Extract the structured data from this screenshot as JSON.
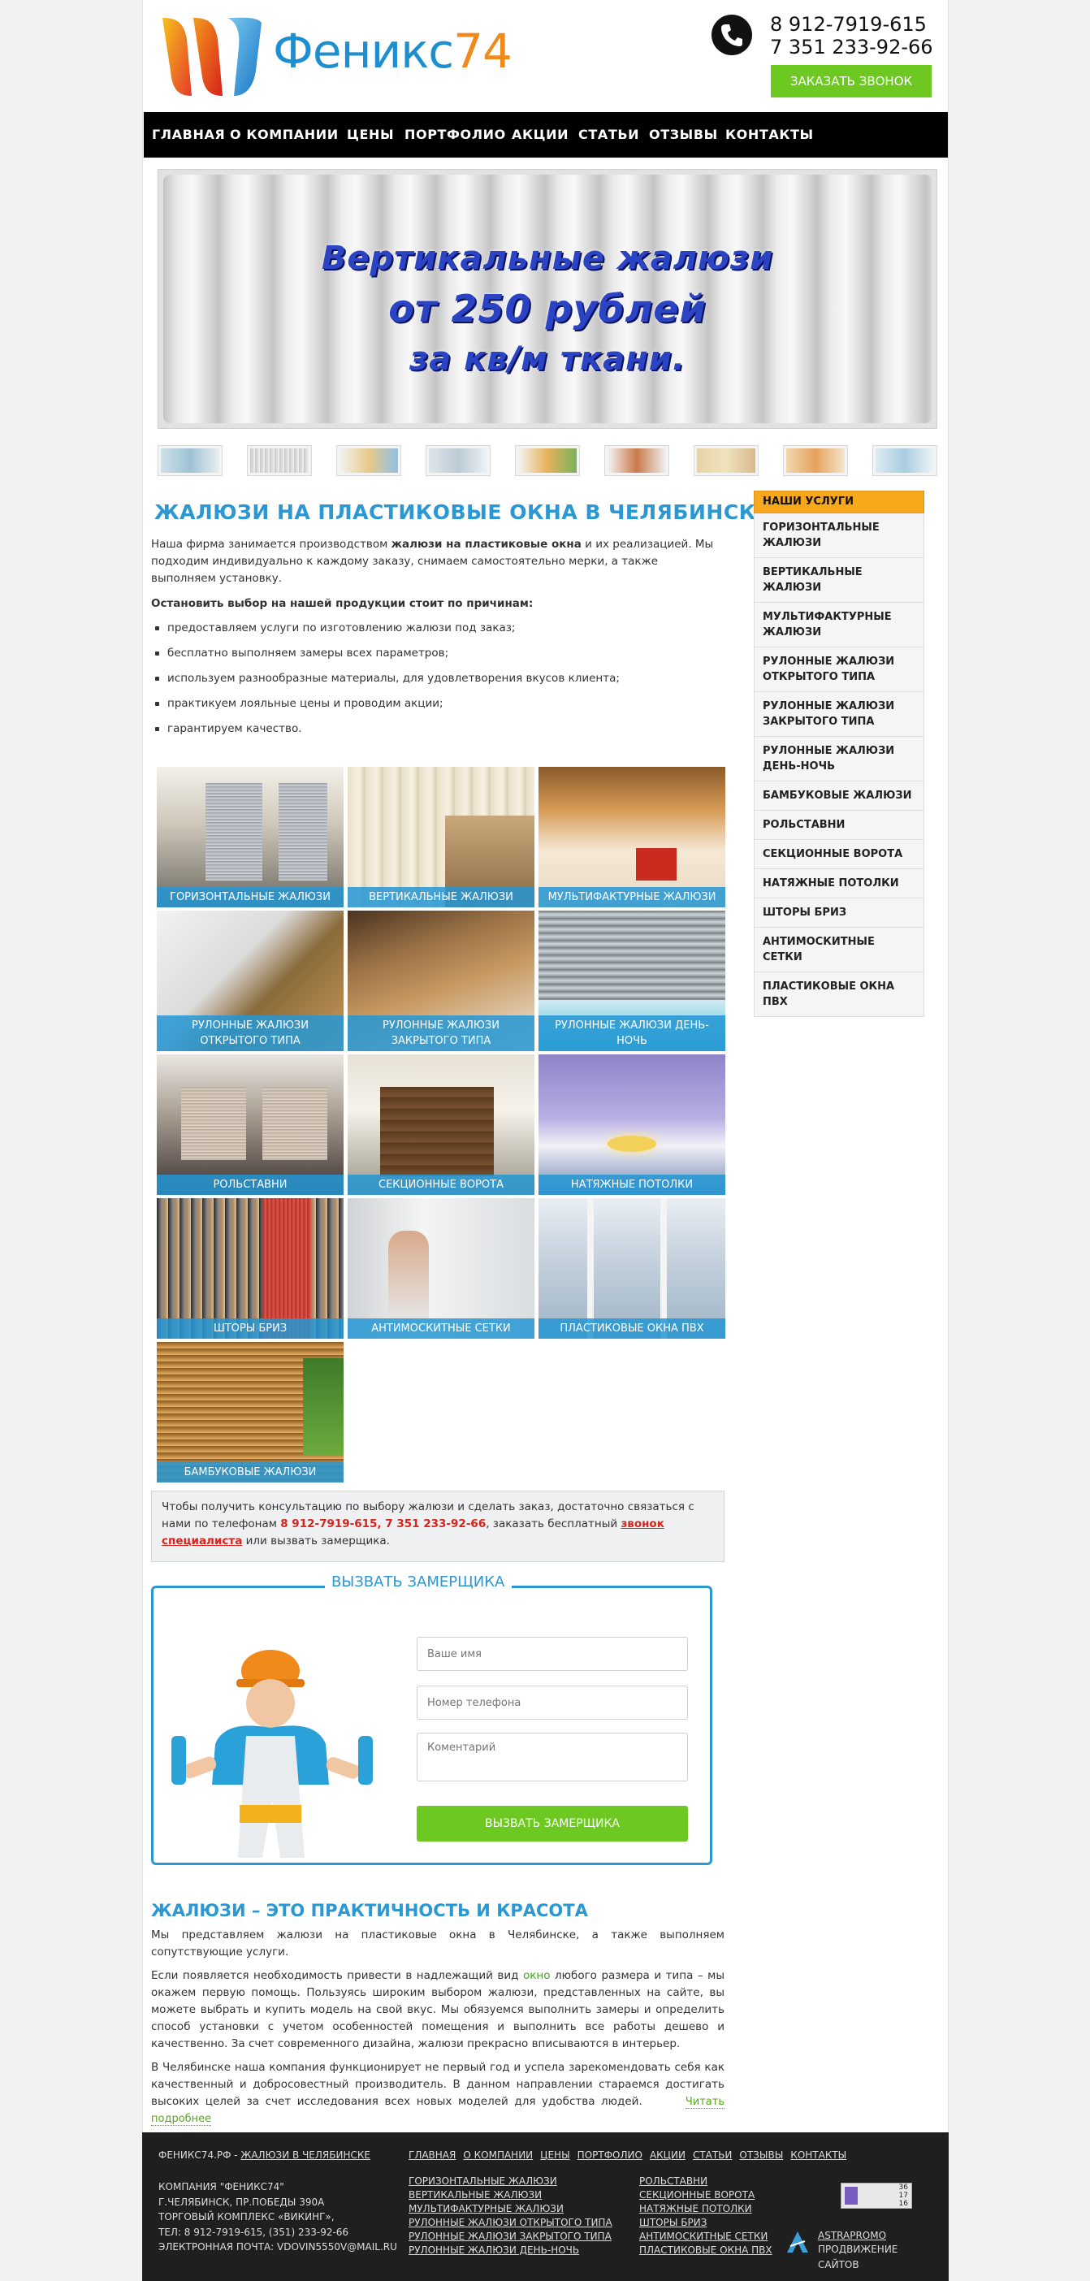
{
  "header": {
    "logo_text": "Феникс",
    "logo_num": "74",
    "phone1": "8 912-7919-615",
    "phone2": "7 351 233-92-66",
    "call_button": "Заказать звонок"
  },
  "nav": [
    "Главная",
    "О компании",
    "Цены",
    "Портфолио",
    "Акции",
    "Статьи",
    "Отзывы",
    "Контакты"
  ],
  "banner": {
    "line1": "Вертикальные жалюзи",
    "line2": "от 250 рублей",
    "line3": "за кв/м ткани."
  },
  "main": {
    "title": "Жалюзи на пластиковые окна в Челябинске",
    "intro_a": "Наша фирма занимается производством ",
    "intro_bold": "жалюзи на пластиковые окна",
    "intro_b": " и их реализацией. Мы подходим индивидуально к каждому заказу, снимаем самостоятельно мерки, а также выполняем установку.",
    "reasons_title": "Остановить выбор на нашей продукции стоит по причинам:",
    "reasons": [
      "предоставляем услуги по изготовлению жалюзи под заказ;",
      "бесплатно выполняем замеры всех параметров;",
      "используем разнообразные материалы, для удовлетворения вкусов клиента;",
      "практикуем лояльные цены и проводим акции;",
      "гарантируем качество."
    ],
    "tiles": [
      "Горизонтальные жалюзи",
      "Вертикальные жалюзи",
      "Мультифактурные жалюзи",
      "Рулонные жалюзи открытого типа",
      "Рулонные жалюзи закрытого типа",
      "Рулонные жалюзи день-ночь",
      "Рольставни",
      "Секционные ворота",
      "Натяжные потолки",
      "Шторы бриз",
      "Антимоскитные сетки",
      "Пластиковые окна ПВХ",
      "Бамбуковые жалюзи"
    ],
    "consult_a": "Чтобы получить консультацию по выбору жалюзи и сделать заказ, достаточно связаться с нами по телефонам ",
    "consult_tel": "8 912-7919-615, 7 351 233-92-66",
    "consult_b": ", заказать бесплатный ",
    "consult_link": "звонок специалиста",
    "consult_c": " или вызвать замерщика."
  },
  "form": {
    "title": "Вызвать замерщика",
    "name_placeholder": "Ваше имя",
    "phone_placeholder": "Номер телефона",
    "comment_placeholder": "Коментарий",
    "submit": "Вызвать замерщика"
  },
  "article": {
    "title": "Жалюзи – это практичность и красота",
    "p1": "Мы представляем жалюзи на пластиковые окна в Челябинске, а также выполняем сопутствующие услуги.",
    "p2_a": "Если появляется необходимость привести в надлежащий вид ",
    "p2_link": "окно",
    "p2_b": " любого размера и типа – мы окажем первую помощь. Пользуясь широким выбором жалюзи, представленных на сайте, вы можете выбрать и купить модель на свой вкус. Мы обязуемся выполнить замеры и определить способ установки с учетом особенностей помещения и выполнить все работы дешево и качественно. За счет современного дизайна, жалюзи прекрасно вписываются в интерьер.",
    "p3": "В Челябинске наша компания функционирует не первый год и успела зарекомендовать себя как качественный и добросовестный производитель. В данном направлении стараемся достигать высоких целей за счет исследования всех новых моделей для удобства людей.",
    "read_more": "Читать подробнее"
  },
  "sidebar": {
    "title": "Наши услуги",
    "items": [
      "Горизонтальные жалюзи",
      "Вертикальные жалюзи",
      "Мультифактурные жалюзи",
      "Рулонные жалюзи открытого типа",
      "Рулонные жалюзи закрытого типа",
      "Рулонные жалюзи день-ночь",
      "Бамбуковые жалюзи",
      "Рольставни",
      "Секционные ворота",
      "Натяжные потолки",
      "Шторы бриз",
      "Антимоскитные сетки",
      "Пластиковые окна ПВХ"
    ]
  },
  "footer": {
    "site": "ФЕНИКС74.РФ - ",
    "site_link": "ЖАЛЮЗИ В ЧЕЛЯБИНСКЕ",
    "company": "КОМПАНИЯ \"ФЕНИКС74\"",
    "address1": "Г.ЧЕЛЯБИНСК, ПР.ПОБЕДЫ 390А",
    "address2": "ТОРГОВЫЙ КОМПЛЕКС «ВИКИНГ»,",
    "phones": "ТЕЛ: 8 912-7919-615, (351) 233-92-66",
    "email": "ЭЛЕКТРОННАЯ ПОЧТА: VDOVIN5550V@MAIL.RU",
    "nav": [
      "Главная",
      "О компании",
      "Цены",
      "Портфолио",
      "Акции",
      "Статьи",
      "Отзывы",
      "Контакты"
    ],
    "col1": [
      "Горизонтальные жалюзи",
      "Вертикальные жалюзи",
      "Мультифактурные жалюзи",
      "Рулонные жалюзи открытого типа",
      "Рулонные жалюзи закрытого типа",
      "Рулонные жалюзи день-ночь"
    ],
    "col2": [
      "Рольставни",
      "Секционные ворота",
      "Натяжные потолки",
      "Шторы бриз",
      "Антимоскитные сетки",
      "Пластиковые окна ПВХ"
    ],
    "counter_values": [
      "36",
      "17",
      "16"
    ],
    "astra_name": "ASTRAPROMO",
    "astra_sub": "ПРОДВИЖЕНИЕ САЙТОВ"
  },
  "colors": {
    "accent_blue": "#2b97d3",
    "green": "#6dc921",
    "orange": "#f7a81b",
    "red": "#d8241c"
  }
}
